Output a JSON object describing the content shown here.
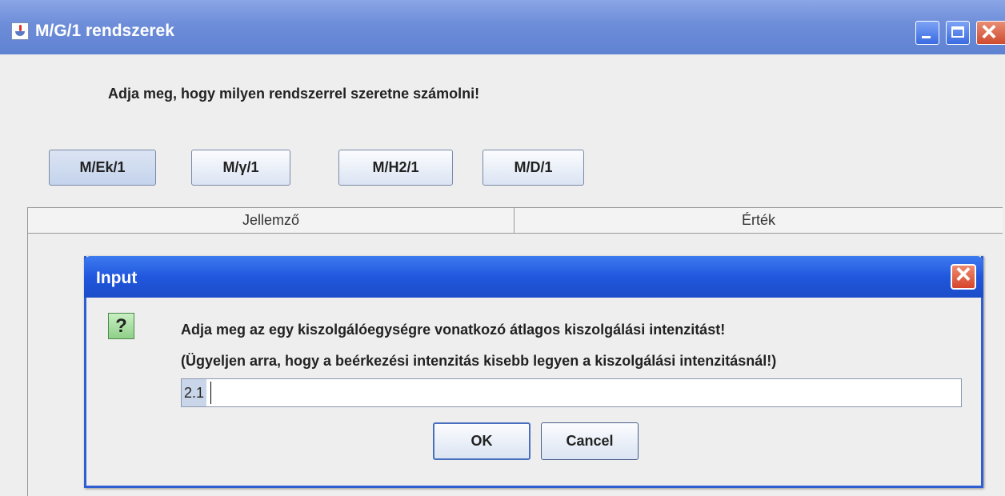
{
  "window": {
    "title": "M/G/1 rendszerek"
  },
  "main": {
    "prompt": "Adja meg, hogy milyen rendszerrel szeretne számolni!",
    "system_buttons": [
      "M/Ek/1",
      "M/γ/1",
      "M/H2/1",
      "M/D/1"
    ]
  },
  "table": {
    "columns": [
      "Jellemző",
      "Érték"
    ]
  },
  "dialog": {
    "title": "Input",
    "icon": "question-icon",
    "message_line1": "Adja meg az egy kiszolgálóegységre vonatkozó átlagos kiszolgálási intenzitást!",
    "message_line2": "(Ügyeljen arra, hogy a beérkezési intenzitás kisebb legyen a kiszolgálási intenzitásnál!)",
    "input_value": "2.1",
    "ok_label": "OK",
    "cancel_label": "Cancel"
  },
  "colors": {
    "titlebar": "#6d8dd9",
    "dialog_titlebar": "#2157dd",
    "background": "#eeeeee"
  }
}
